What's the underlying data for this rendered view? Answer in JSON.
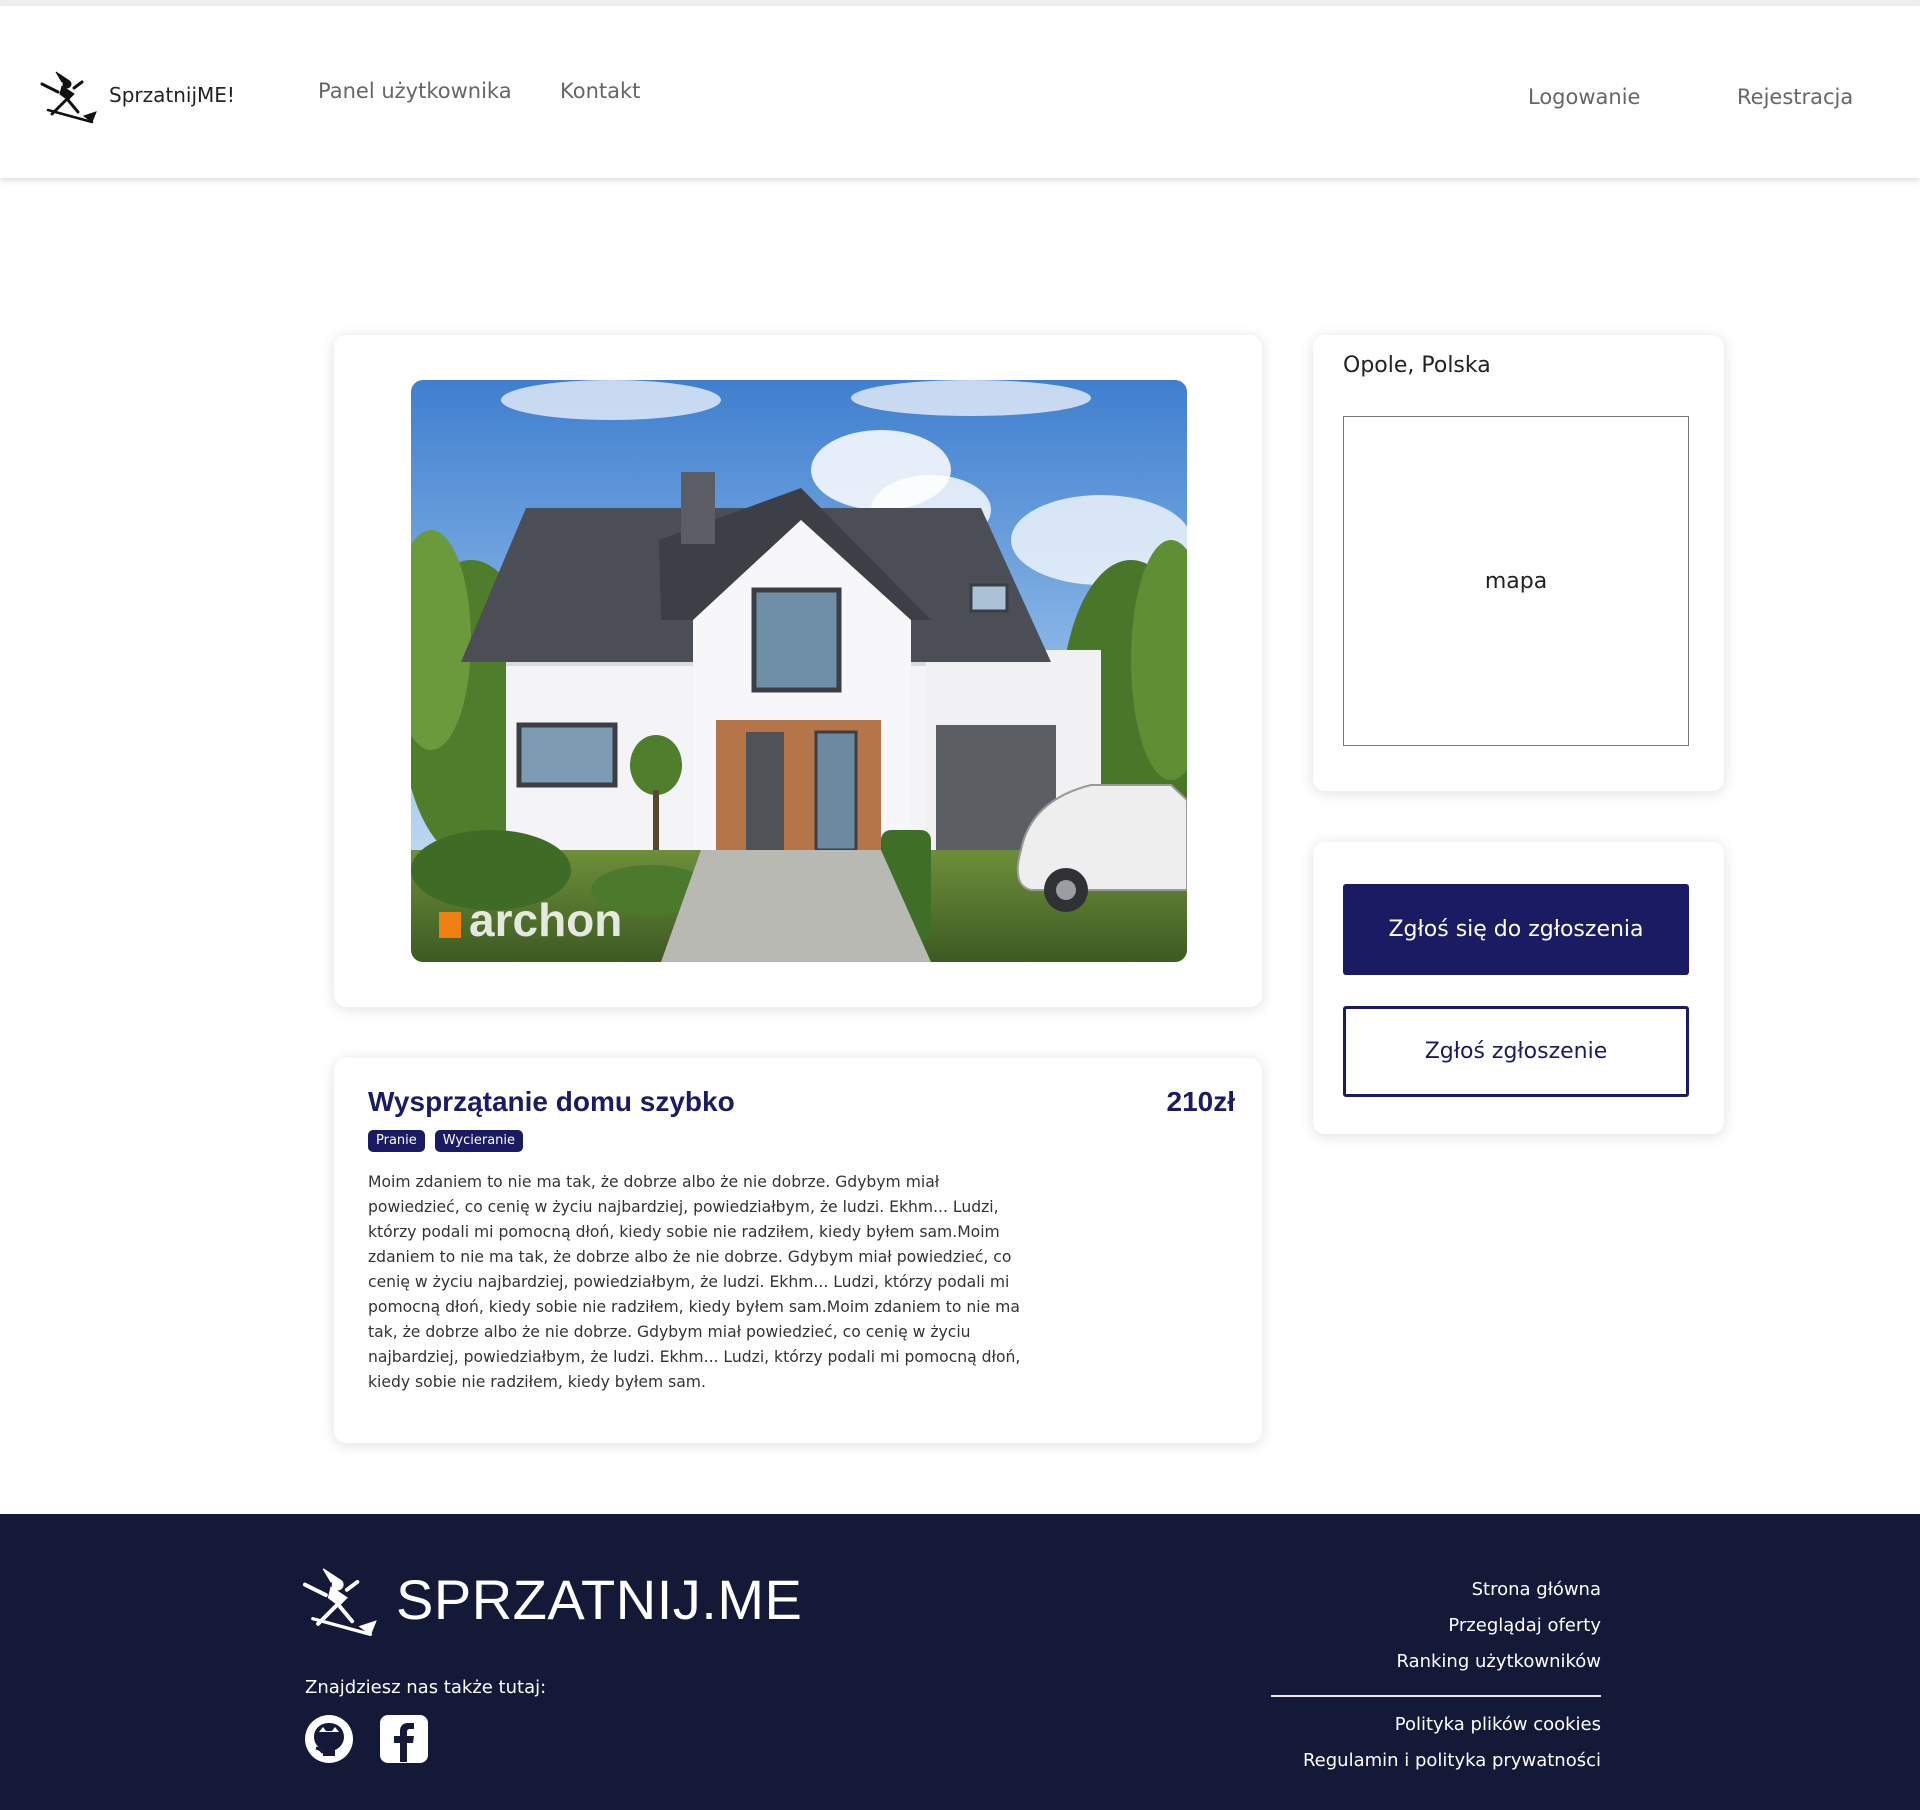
{
  "navbar": {
    "brand": "SprzatnijME!",
    "links": [
      {
        "label": "Panel użytkownika"
      },
      {
        "label": "Kontakt"
      }
    ],
    "login": "Logowanie",
    "register": "Rejestracja"
  },
  "offer": {
    "photo_watermark": "archon",
    "title": "Wysprzątanie domu szybko",
    "price": "210zł",
    "tags": [
      "Pranie",
      "Wycieranie"
    ],
    "description": "Moim zdaniem to nie ma tak, że dobrze albo że nie dobrze. Gdybym miał powiedzieć, co cenię w życiu najbardziej, powiedziałbym, że ludzi. Ekhm... Ludzi, którzy podali mi pomocną dłoń, kiedy sobie nie radziłem, kiedy byłem sam.Moim zdaniem to nie ma tak, że dobrze albo że nie dobrze. Gdybym miał powiedzieć, co cenię w życiu najbardziej, powiedziałbym, że ludzi. Ekhm... Ludzi, którzy podali mi pomocną dłoń, kiedy sobie nie radziłem, kiedy byłem sam.Moim zdaniem to nie ma tak, że dobrze albo że nie dobrze. Gdybym miał powiedzieć, co cenię w życiu najbardziej, powiedziałbym, że ludzi. Ekhm... Ludzi, którzy podali mi pomocną dłoń, kiedy sobie nie radziłem, kiedy byłem sam."
  },
  "location": {
    "city": "Opole, Polska",
    "map_placeholder": "mapa"
  },
  "actions": {
    "apply": "Zgłoś się do zgłoszenia",
    "report": "Zgłoś zgłoszenie"
  },
  "footer": {
    "brand": "SPRZATNIJ.ME",
    "find_us": "Znajdziesz nas także tutaj:",
    "social_icons": [
      "github-icon",
      "facebook-icon"
    ],
    "links_primary": [
      "Strona główna",
      "Przeglądaj oferty",
      "Ranking użytkowników"
    ],
    "links_secondary": [
      "Polityka plików cookies",
      "Regulamin i polityka prywatności"
    ]
  },
  "colors": {
    "accent": "#1b1b63",
    "footer_bg": "#141938"
  }
}
